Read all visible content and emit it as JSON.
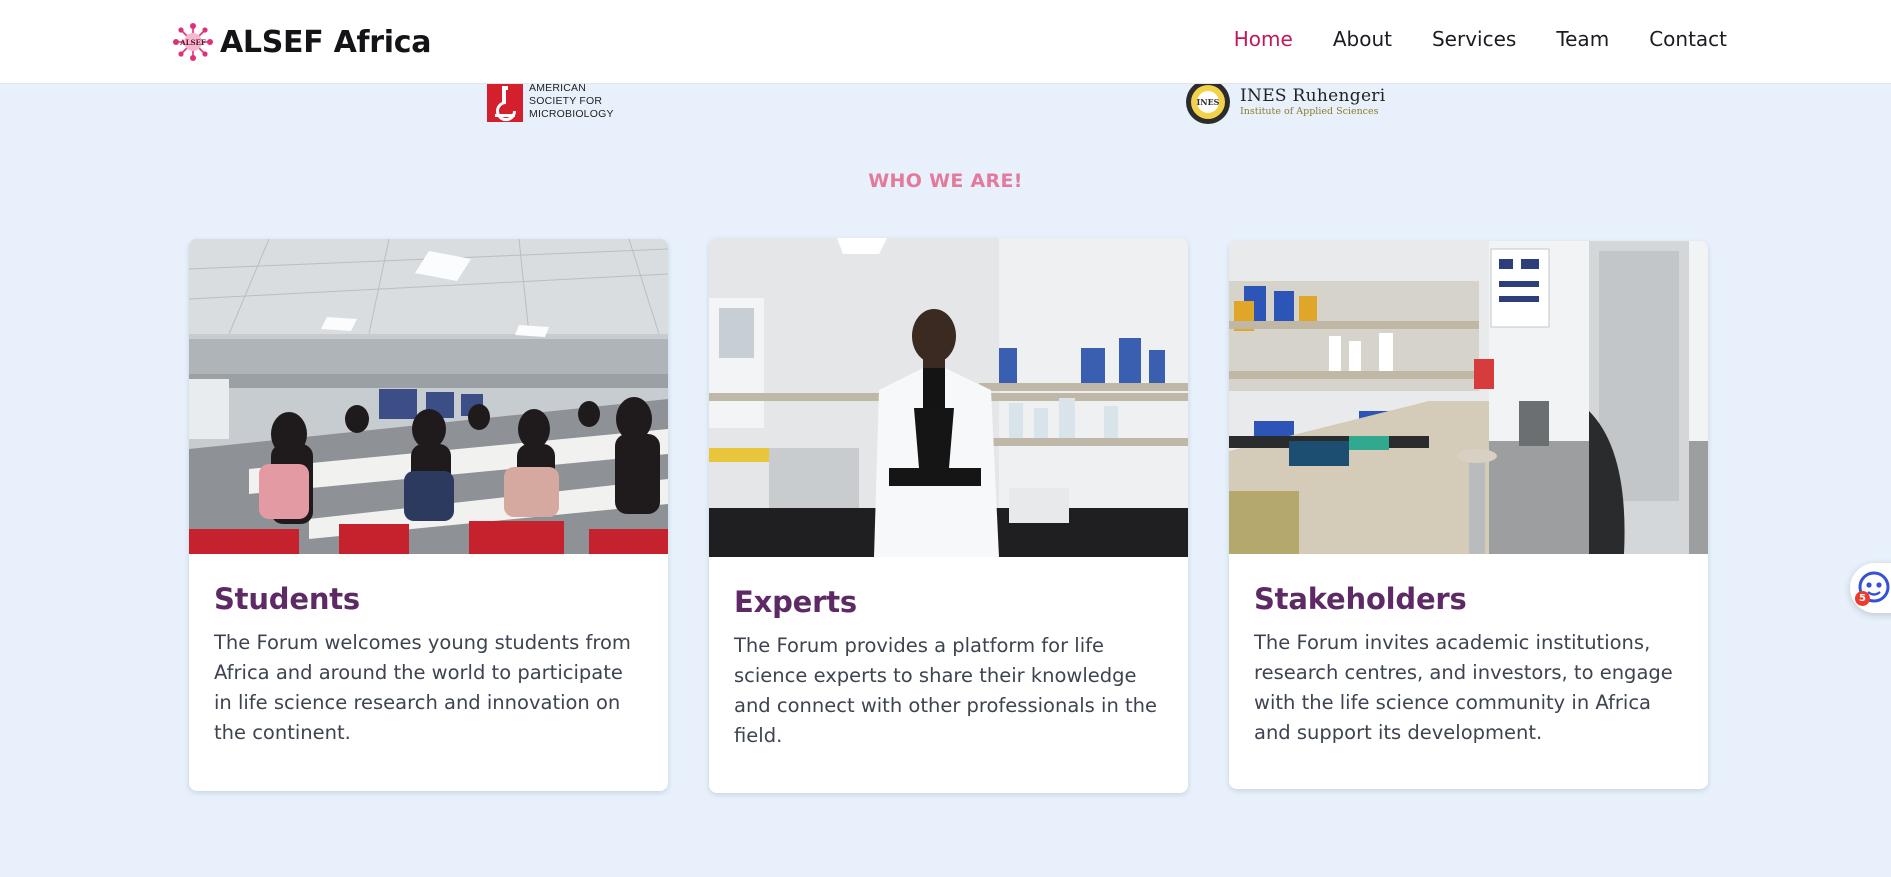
{
  "brand": {
    "logo_text": "ALSEF",
    "name": "ALSEF Africa"
  },
  "nav": [
    {
      "label": "Home",
      "active": true
    },
    {
      "label": "About",
      "active": false
    },
    {
      "label": "Services",
      "active": false
    },
    {
      "label": "Team",
      "active": false
    },
    {
      "label": "Contact",
      "active": false
    }
  ],
  "partners": {
    "asm": {
      "line1": "AMERICAN",
      "line2": "SOCIETY FOR",
      "line3": "MICROBIOLOGY"
    },
    "ines": {
      "seal_text": "INES",
      "name": "INES Ruhengeri",
      "subtitle": "Institute of Applied Sciences"
    }
  },
  "section": {
    "title": "WHO WE ARE!"
  },
  "cards": [
    {
      "title": "Students",
      "text": "The Forum welcomes young students from Africa and around the world to participate in life science research and innovation on the continent.",
      "image": "students-classroom-photo"
    },
    {
      "title": "Experts",
      "text": "The Forum provides a platform for life science experts to share their knowledge and connect with other professionals in the field.",
      "image": "expert-in-lab-photo"
    },
    {
      "title": "Stakeholders",
      "text": "The Forum invites academic institutions, research centres, and investors, to engage with the life science community in Africa and support its development.",
      "image": "laboratory-photo"
    }
  ],
  "chat": {
    "badge": "5",
    "icon": "chat-face-icon"
  },
  "colors": {
    "page_bg": "#e8f1fb",
    "nav_active": "#c2185b",
    "section_title": "#e37a9c",
    "card_title": "#5e2a66",
    "card_text": "#3d4450"
  }
}
